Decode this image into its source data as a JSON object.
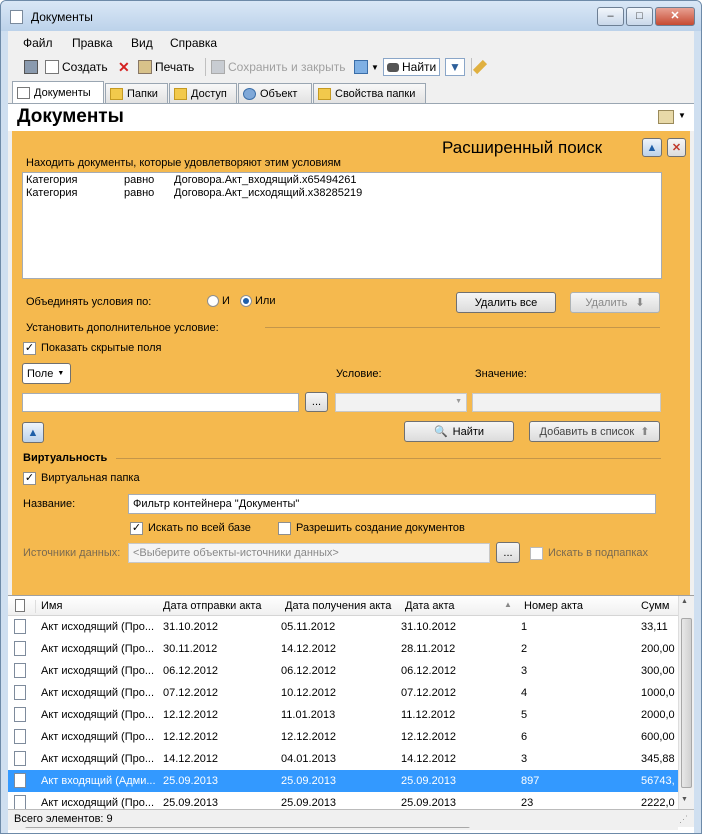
{
  "window": {
    "title": "Документы"
  },
  "menu": [
    "Файл",
    "Правка",
    "Вид",
    "Справка"
  ],
  "toolbar": {
    "create": "Создать",
    "print": "Печать",
    "save_close": "Сохранить и закрыть",
    "find": "Найти"
  },
  "tabs": [
    "Документы",
    "Папки",
    "Доступ",
    "Объект",
    "Свойства папки"
  ],
  "page_title": "Документы",
  "search": {
    "title": "Расширенный поиск",
    "hint": "Находить документы, которые удовлетворяют этим условиям",
    "conditions": [
      {
        "field": "Категория",
        "op": "равно",
        "value": "Договора.Акт_входящий.x65494261"
      },
      {
        "field": "Категория",
        "op": "равно",
        "value": "Договора.Акт_исходящий.x38285219"
      }
    ],
    "combine_label": "Объединять условия по:",
    "combine_and": "И",
    "combine_or": "Или",
    "combine_selected": "Или",
    "delete_all": "Удалить все",
    "delete": "Удалить",
    "extra_label": "Установить дополнительное условие:",
    "show_hidden": "Показать скрытые поля",
    "field_dropdown": "Поле",
    "condition_label": "Условие:",
    "value_label": "Значение:",
    "ellipsis": "...",
    "find_button": "Найти",
    "add_to_list": "Добавить в список"
  },
  "virtuality": {
    "section": "Виртуальность",
    "virtual_folder": "Виртуальная папка",
    "name_label": "Название:",
    "name_value": "Фильтр контейнера \"Документы\"",
    "search_all": "Искать по всей базе",
    "allow_create": "Разрешить создание документов",
    "sources_label": "Источники данных:",
    "sources_placeholder": "<Выберите объекты-источники данных>",
    "ellipsis": "...",
    "search_subfolders": "Искать в подпапках"
  },
  "grid": {
    "columns": [
      "Имя",
      "Дата отправки акта",
      "Дата получения акта",
      "Дата акта",
      "Номер акта",
      "Сумм"
    ],
    "rows": [
      [
        "Акт исходящий (Про...",
        "31.10.2012",
        "05.11.2012",
        "31.10.2012",
        "1",
        "33,11"
      ],
      [
        "Акт исходящий (Про...",
        "30.11.2012",
        "14.12.2012",
        "28.11.2012",
        "2",
        "200,00"
      ],
      [
        "Акт исходящий (Про...",
        "06.12.2012",
        "06.12.2012",
        "06.12.2012",
        "3",
        "300,00"
      ],
      [
        "Акт исходящий (Про...",
        "07.12.2012",
        "10.12.2012",
        "07.12.2012",
        "4",
        "1000,0"
      ],
      [
        "Акт исходящий (Про...",
        "12.12.2012",
        "11.01.2013",
        "11.12.2012",
        "5",
        "2000,0"
      ],
      [
        "Акт исходящий (Про...",
        "12.12.2012",
        "12.12.2012",
        "12.12.2012",
        "6",
        "600,00"
      ],
      [
        "Акт исходящий (Про...",
        "14.12.2012",
        "04.01.2013",
        "14.12.2012",
        "3",
        "345,88"
      ],
      [
        "Акт входящий (Адми...",
        "25.09.2013",
        "25.09.2013",
        "25.09.2013",
        "897",
        "56743,"
      ],
      [
        "Акт исходящий (Про...",
        "25.09.2013",
        "25.09.2013",
        "25.09.2013",
        "23",
        "2222,0"
      ]
    ],
    "selected_row": 7
  },
  "status": "Всего элементов: 9",
  "colors": {
    "panel": "#f5b94e",
    "selection": "#3399ff"
  }
}
